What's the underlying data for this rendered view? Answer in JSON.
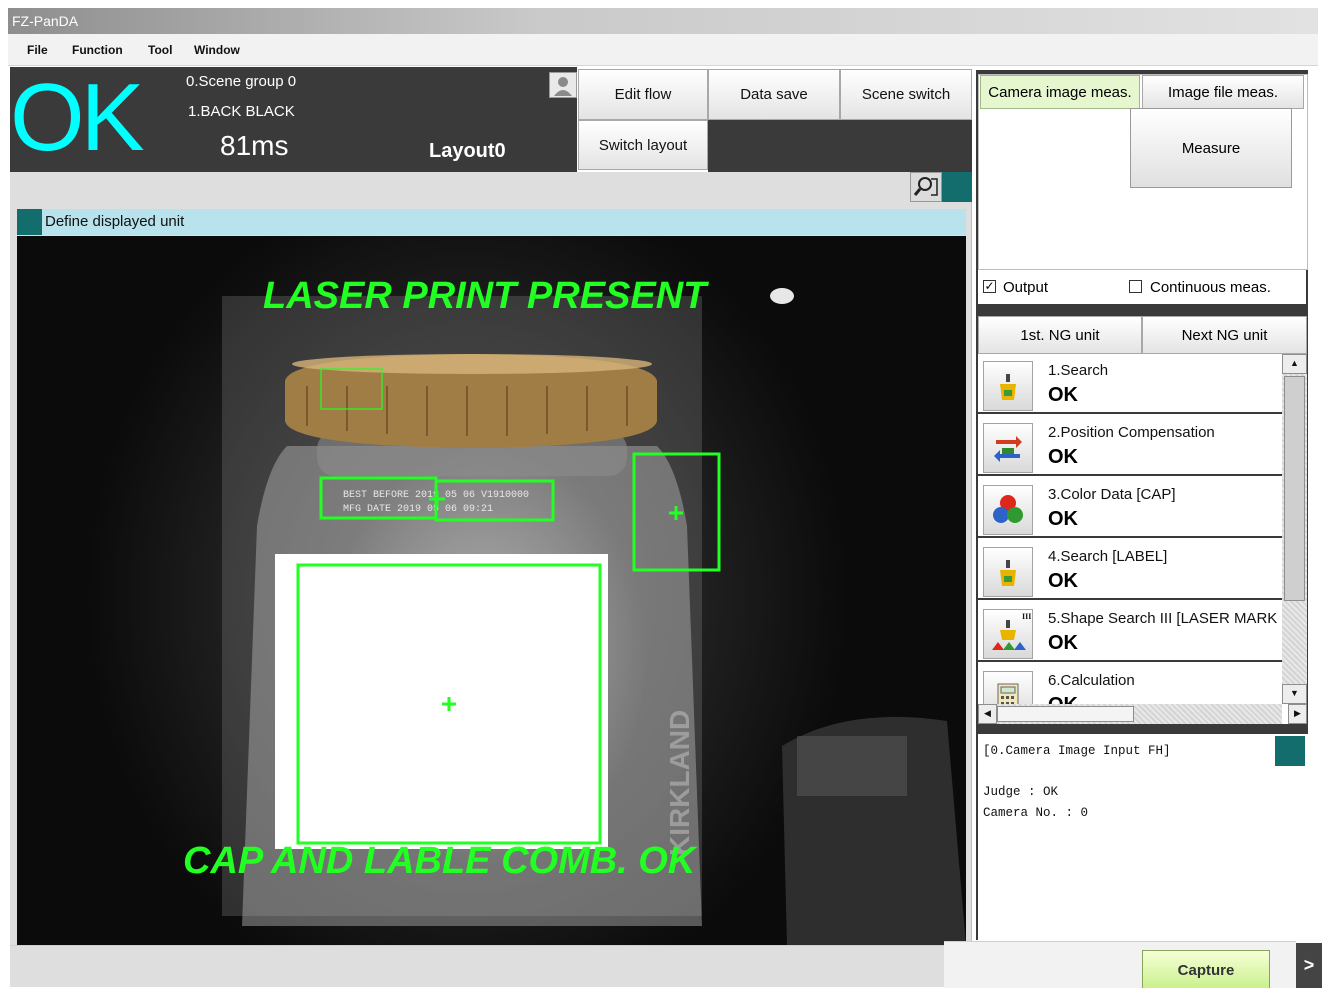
{
  "window": {
    "title": "FZ-PanDA"
  },
  "menu": [
    "File",
    "Function",
    "Tool",
    "Window"
  ],
  "status": {
    "judge": "OK",
    "scene_group": "0.Scene group 0",
    "scene": "1.BACK BLACK",
    "time": "81ms",
    "layout": "Layout0"
  },
  "toolbar": {
    "edit_flow": "Edit flow",
    "data_save": "Data save",
    "scene_switch": "Scene switch",
    "switch_layout": "Switch layout"
  },
  "image_panel": {
    "unit_bar_label": "Define displayed unit",
    "overlay_top": "LASER PRINT PRESENT",
    "overlay_bottom": "CAP AND LABLE COMB. OK",
    "label_text_line1": "BEST BEFORE 2019 05 06 V1910000",
    "label_text_line2": "MFG DATE 2019 05 06 09:21"
  },
  "measure_panel": {
    "tab_camera": "Camera image meas.",
    "tab_file": "Image file meas.",
    "measure_button": "Measure",
    "output_label": "Output",
    "output_checked": true,
    "continuous_label": "Continuous meas.",
    "continuous_checked": false,
    "first_ng": "1st. NG unit",
    "next_ng": "Next NG unit"
  },
  "units": [
    {
      "name": "1.Search",
      "judge": "OK",
      "icon": "search-unit-icon"
    },
    {
      "name": "2.Position Compensation",
      "judge": "OK",
      "icon": "position-compensation-icon"
    },
    {
      "name": "3.Color Data [CAP]",
      "judge": "OK",
      "icon": "color-data-icon"
    },
    {
      "name": "4.Search [LABEL]",
      "judge": "OK",
      "icon": "search-unit-icon"
    },
    {
      "name": "5.Shape Search III [LASER MARK",
      "judge": "OK",
      "icon": "shape-search-icon"
    },
    {
      "name": "6.Calculation",
      "judge": "OK",
      "icon": "calculator-icon"
    }
  ],
  "detail": {
    "header": "[0.Camera Image Input FH]",
    "judge_line": "Judge : OK",
    "camera_line": "Camera No. : 0"
  },
  "footer": {
    "capture_button": "Capture",
    "expand_button": ">"
  },
  "colors": {
    "judge_ok": "#00ffff",
    "overlay_green": "#22ff22",
    "accent_teal": "#146d6d",
    "header_dark": "#3a3a3a"
  }
}
